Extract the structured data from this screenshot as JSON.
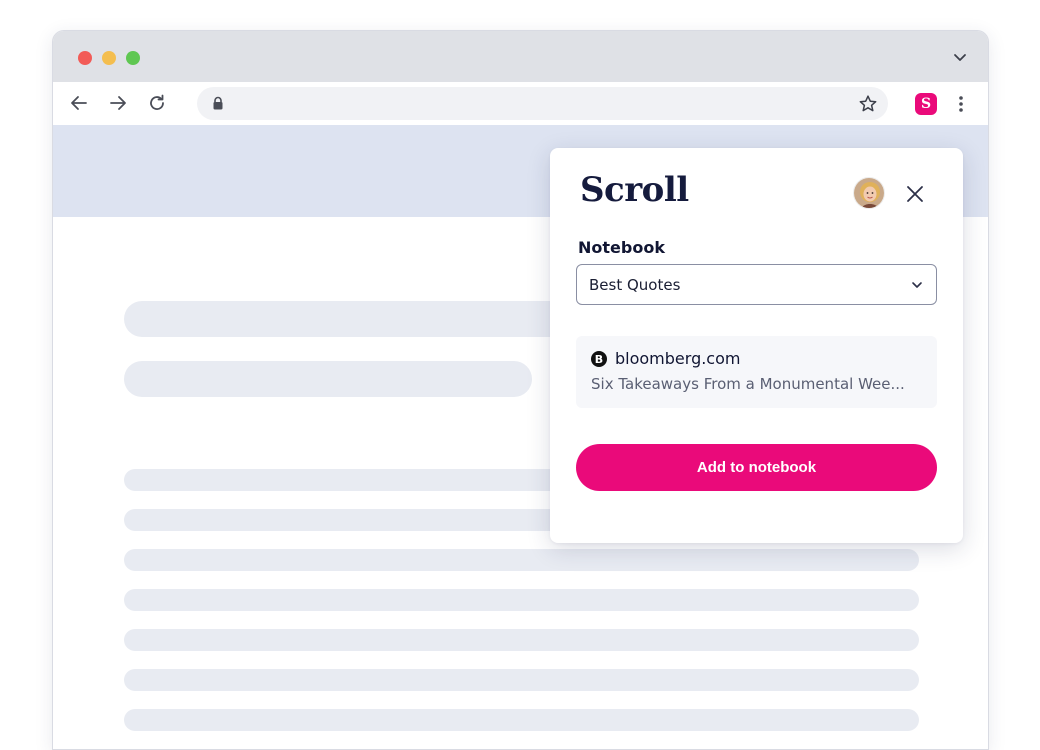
{
  "browser": {
    "address_text": "",
    "extension_letter": "S"
  },
  "popup": {
    "brand": "Scroll",
    "notebook_label": "Notebook",
    "notebook_selected": "Best Quotes",
    "source": {
      "logo_letter": "B",
      "domain": "bloomberg.com",
      "title": "Six Takeaways From a Monumental Wee..."
    },
    "add_button_label": "Add to notebook"
  },
  "icons": {
    "window_controls": [
      "close-dot",
      "minimize-dot",
      "maximize-dot"
    ],
    "toolbar": [
      "back-arrow-icon",
      "forward-arrow-icon",
      "reload-icon",
      "lock-icon",
      "star-icon",
      "scroll-extension-icon",
      "kebab-menu-icon"
    ],
    "popup": [
      "avatar",
      "close-icon",
      "chevron-down-icon",
      "bloomberg-logo-icon"
    ]
  },
  "colors": {
    "accent": "#ea0a7a",
    "brand_text": "#151b3d",
    "hero_band": "#dde3f1",
    "skeleton": "#e8ebf2"
  }
}
